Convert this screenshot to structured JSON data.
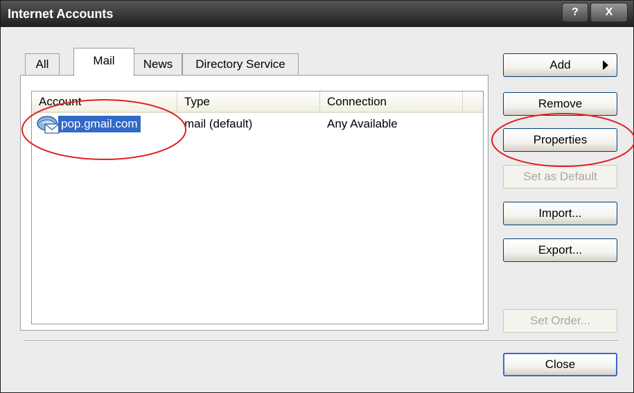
{
  "window": {
    "title": "Internet Accounts"
  },
  "caption_buttons": {
    "help": "?",
    "close": "X"
  },
  "tabs": [
    {
      "label": "All",
      "active": false
    },
    {
      "label": "Mail",
      "active": true
    },
    {
      "label": "News",
      "active": false
    },
    {
      "label": "Directory Service",
      "active": false
    }
  ],
  "list": {
    "columns": [
      "Account",
      "Type",
      "Connection"
    ],
    "rows": [
      {
        "account": "pop.gmail.com",
        "type": "mail (default)",
        "connection": "Any Available",
        "selected": true
      }
    ]
  },
  "buttons": {
    "add": "Add",
    "remove": "Remove",
    "properties": "Properties",
    "set_default": "Set as Default",
    "import": "Import...",
    "export": "Export...",
    "set_order": "Set Order...",
    "close": "Close"
  },
  "annotation_color": "#e02020"
}
